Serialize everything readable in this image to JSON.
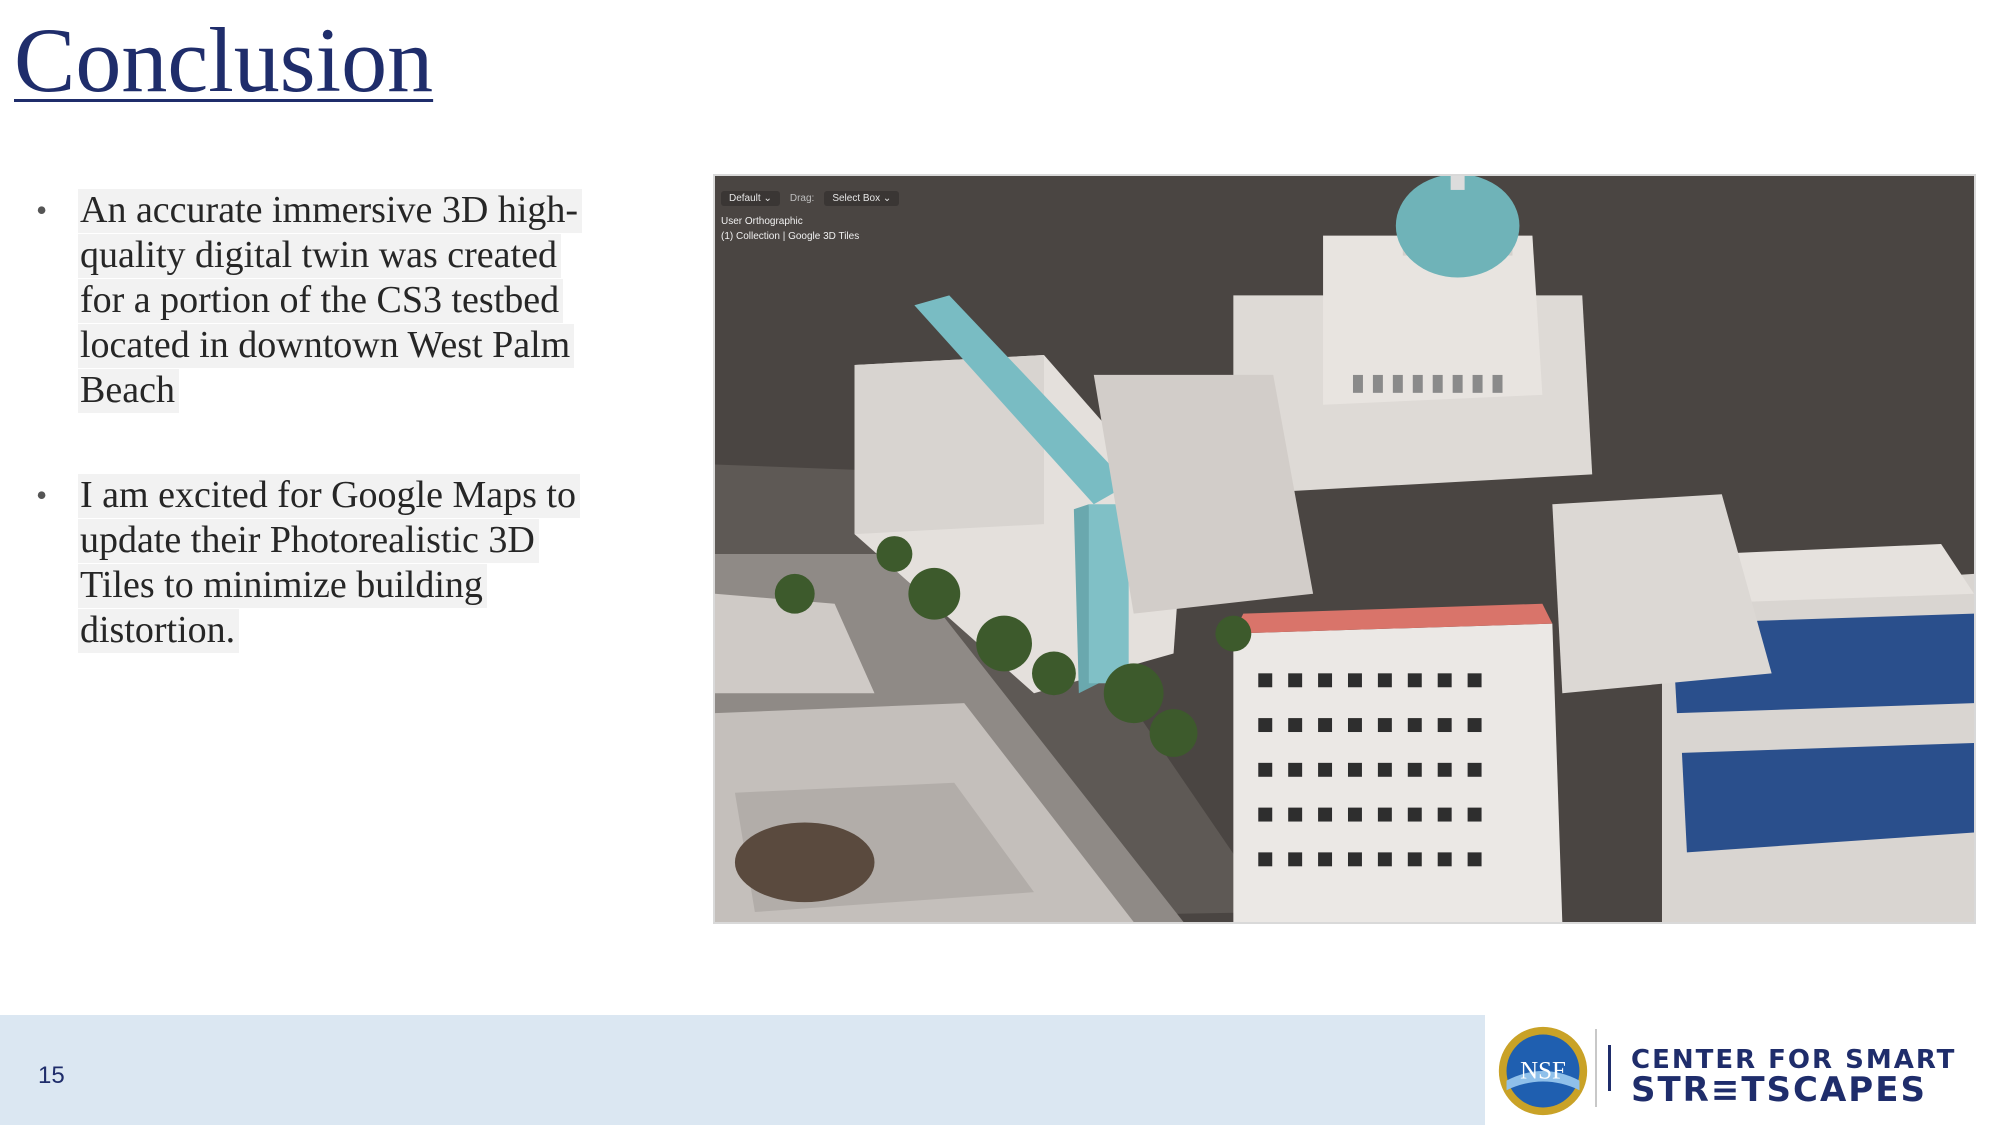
{
  "slide": {
    "title": "Conclusion",
    "bullets": [
      "An accurate immersive 3D high-quality digital twin was created for a portion of the CS3 testbed located in downtown West Palm Beach",
      "I am excited for Google Maps to update their Photorealistic 3D Tiles to minimize building distortion."
    ],
    "bullet_glyph": "•"
  },
  "viewport": {
    "mode": "Default",
    "drag_label": "Drag:",
    "drag_value": "Select Box",
    "view_name": "User Orthographic",
    "collection": "(1) Collection | Google 3D Tiles",
    "dropdown_icon": "chevron-down-icon"
  },
  "footer": {
    "page_number": "15",
    "logo_nsf": "NSF",
    "logo_line1": "CENTER FOR SMART",
    "logo_line2": "STR≡TSCAPES"
  },
  "colors": {
    "title": "#1f2d6b",
    "footer_bg": "#dbe7f2",
    "dome": "#6fb3b8",
    "ground": "#4a4542"
  }
}
